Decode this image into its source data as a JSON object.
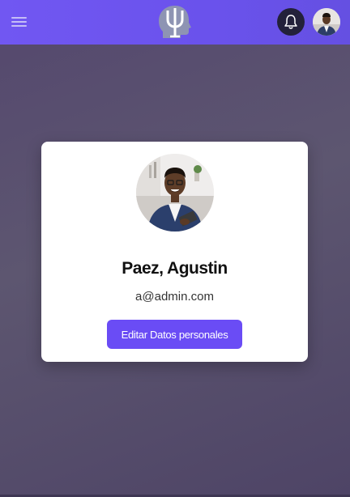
{
  "header": {
    "menu_icon": "hamburger-menu-icon",
    "logo_icon": "psi-logo-icon",
    "notification_icon": "bell-icon",
    "user_avatar_icon": "user-avatar"
  },
  "profile": {
    "name": "Paez, Agustin",
    "email": "a@admin.com",
    "edit_button_label": "Editar Datos personales"
  },
  "colors": {
    "header_bg": "#6a52ec",
    "accent": "#6a4cf5",
    "bell_bg": "#23213a",
    "page_bg": "#5a5070"
  }
}
